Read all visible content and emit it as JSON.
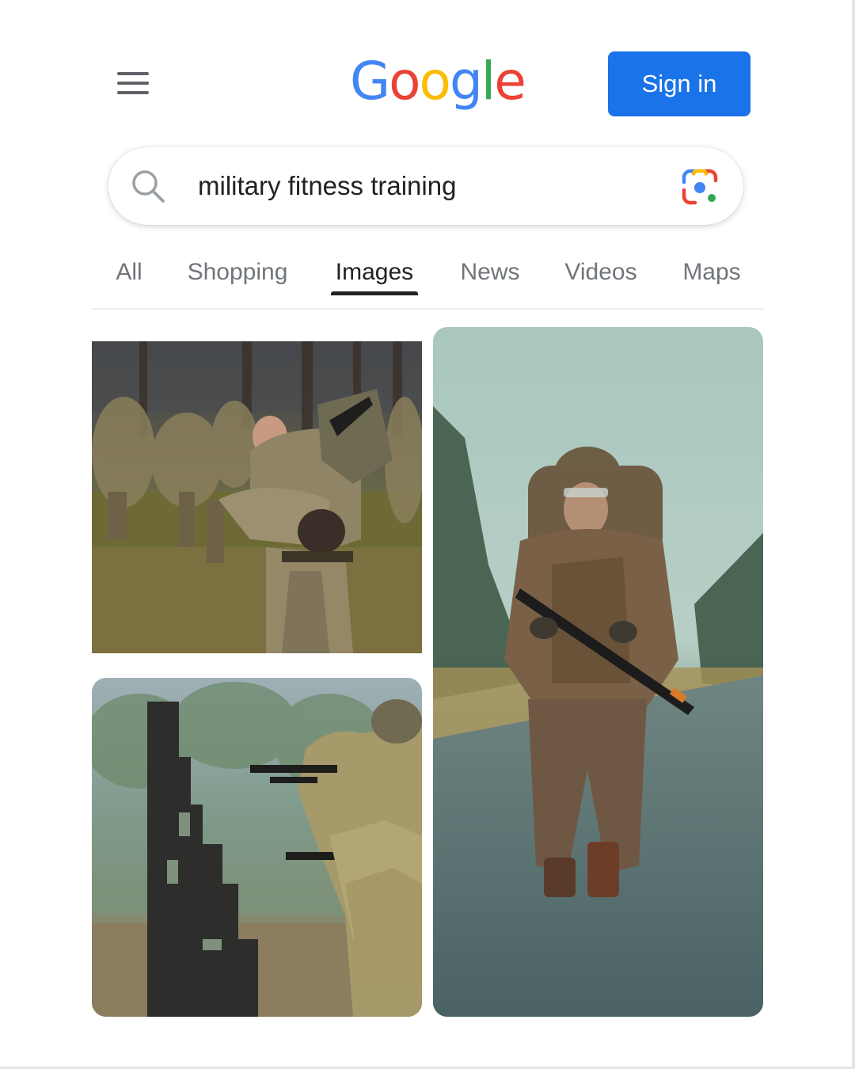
{
  "header": {
    "menu_icon": "hamburger-menu-icon",
    "logo": {
      "letters": [
        {
          "char": "G",
          "color": "#4285F4"
        },
        {
          "char": "o",
          "color": "#EA4335"
        },
        {
          "char": "o",
          "color": "#FBBC05"
        },
        {
          "char": "g",
          "color": "#4285F4"
        },
        {
          "char": "l",
          "color": "#34A853"
        },
        {
          "char": "e",
          "color": "#EA4335"
        }
      ]
    },
    "signin_label": "Sign in",
    "signin_color": "#1a73e8"
  },
  "search": {
    "icon": "search-icon",
    "query": "military fitness training",
    "lens_icon": "google-lens-icon"
  },
  "tabs": {
    "items": [
      {
        "label": "All",
        "active": false
      },
      {
        "label": "Shopping",
        "active": false
      },
      {
        "label": "Images",
        "active": true
      },
      {
        "label": "News",
        "active": false
      },
      {
        "label": "Videos",
        "active": false
      },
      {
        "label": "Maps",
        "active": false
      }
    ]
  },
  "results": {
    "images": [
      {
        "name": "soldier-fireman-carry-photo"
      },
      {
        "name": "soldiers-aiming-rifles-photo"
      },
      {
        "name": "soldier-ruck-march-photo"
      }
    ]
  }
}
